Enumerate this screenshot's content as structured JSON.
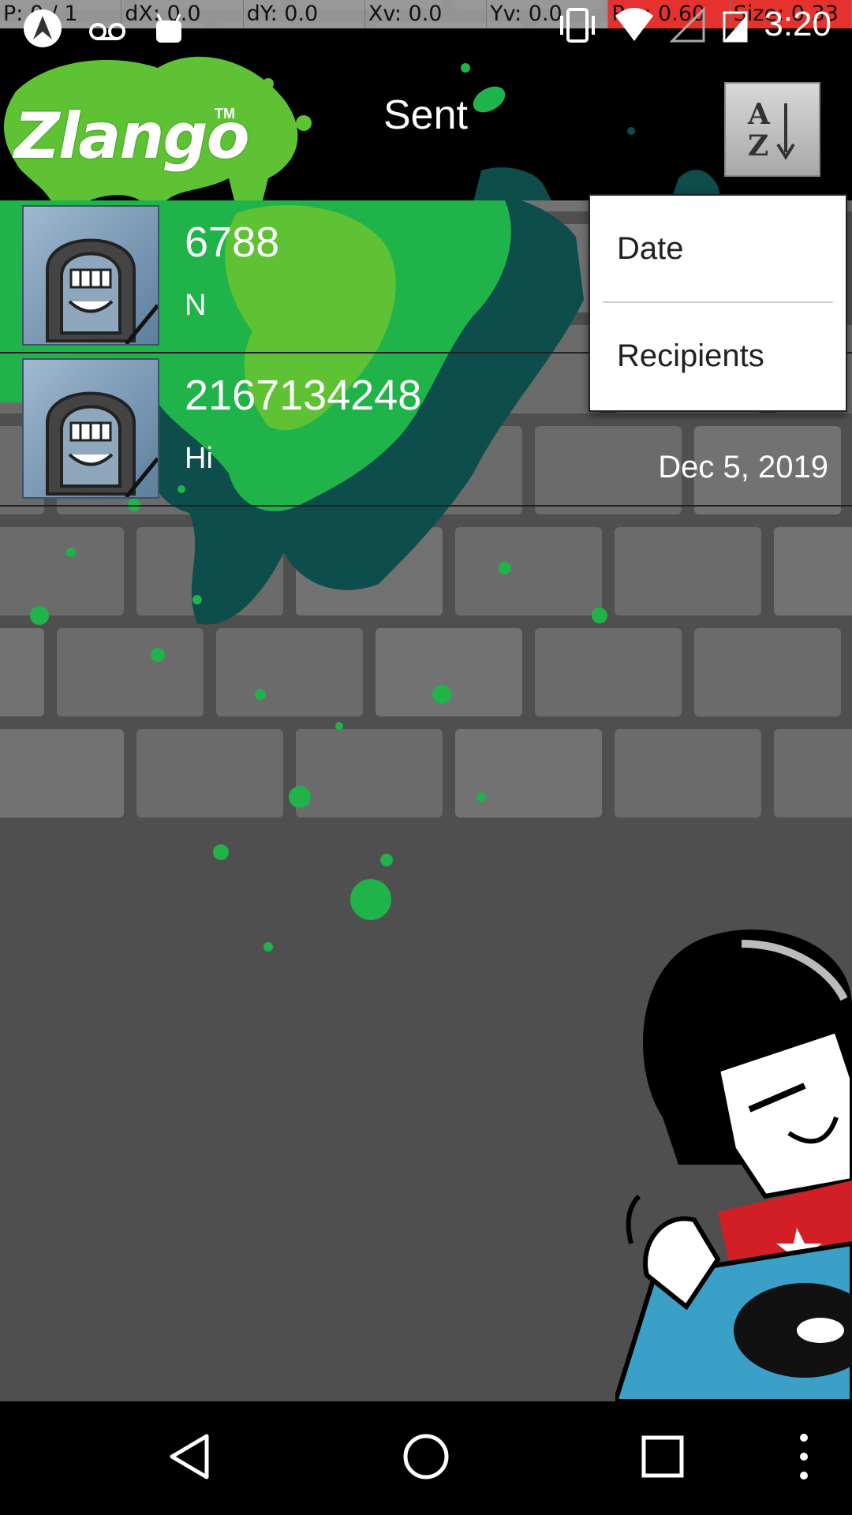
{
  "debug": {
    "cells": [
      "P: 0 / 1",
      "dX: 0.0",
      "dY: 0.0",
      "Xv: 0.0",
      "Yv: 0.0",
      "Prs: 0.60",
      "Size: 0.33"
    ]
  },
  "status_bar": {
    "time": "3:20",
    "icons": [
      "app-notification-icon",
      "voicemail-icon",
      "android-icon",
      "vibrate-icon",
      "wifi-icon",
      "signal-icon",
      "battery-charging-icon"
    ]
  },
  "header": {
    "logo": "Zlango",
    "logo_tm": "TM",
    "title": "Sent",
    "sort_icon": "sort-az-icon"
  },
  "messages": [
    {
      "recipient": "6788",
      "preview": "N",
      "date": ""
    },
    {
      "recipient": "2167134248",
      "preview": "Hi",
      "date": "Dec 5, 2019"
    }
  ],
  "sort_menu": {
    "items": [
      "Date",
      "Recipients"
    ]
  },
  "nav": {
    "icons": [
      "back-icon",
      "home-icon",
      "recents-icon",
      "overflow-menu-icon"
    ]
  },
  "colors": {
    "splash_bright": "#5fc234",
    "splash_mid": "#20b34a",
    "splash_dark": "#0d4d4c",
    "brick": "#6b6b6b",
    "mortar": "#444444"
  }
}
